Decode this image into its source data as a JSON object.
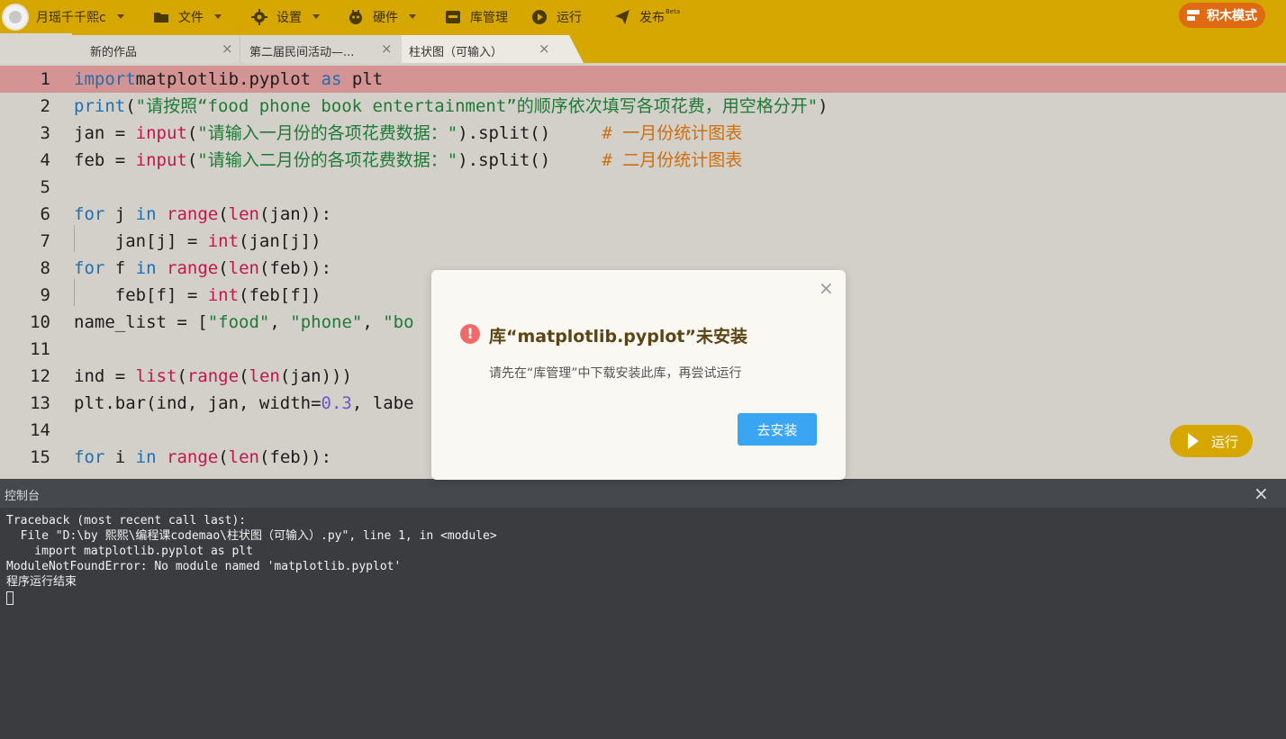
{
  "topbar": {
    "user": "月瑶千千熙c",
    "menu": {
      "file": "文件",
      "settings": "设置",
      "hardware": "硬件",
      "libraries": "库管理",
      "run": "运行",
      "publish": "发布",
      "publish_badge": "Beta"
    },
    "mode_button": "积木模式",
    "colors": {
      "bar": "#d6a700",
      "mode_button": "#e06a12"
    }
  },
  "tabs": [
    {
      "label": "新的作品",
      "close": "×"
    },
    {
      "label": "第二届民间活动—...",
      "close": "×"
    },
    {
      "label": "柱状图（可输入）",
      "close": "×"
    }
  ],
  "editor": {
    "lines": [
      {
        "n": "1",
        "tokens": [
          [
            "kw",
            "import"
          ],
          [
            "",
            "matplotlib.pyplot "
          ],
          [
            "kw",
            "as"
          ],
          [
            "",
            " plt"
          ]
        ]
      },
      {
        "n": "2",
        "tokens": [
          [
            "kw",
            "print"
          ],
          [
            "",
            "("
          ],
          [
            "st",
            "\"请按照“food phone book entertainment”的顺序依次填写各项花费，用空格分开\""
          ],
          [
            "",
            ")"
          ]
        ]
      },
      {
        "n": "3",
        "tokens": [
          [
            "",
            "jan = "
          ],
          [
            "fn",
            "input"
          ],
          [
            "",
            "("
          ],
          [
            "st",
            "\"请输入一月份的各项花费数据：\""
          ],
          [
            "",
            ").split()     "
          ],
          [
            "cm",
            "# 一月份统计图表"
          ]
        ]
      },
      {
        "n": "4",
        "tokens": [
          [
            "",
            "feb = "
          ],
          [
            "fn",
            "input"
          ],
          [
            "",
            "("
          ],
          [
            "st",
            "\"请输入二月份的各项花费数据：\""
          ],
          [
            "",
            ").split()     "
          ],
          [
            "cm",
            "# 二月份统计图表"
          ]
        ]
      },
      {
        "n": "5",
        "tokens": []
      },
      {
        "n": "6",
        "tokens": [
          [
            "kw",
            "for"
          ],
          [
            "",
            " j "
          ],
          [
            "kw",
            "in"
          ],
          [
            "",
            " "
          ],
          [
            "fn",
            "range"
          ],
          [
            "",
            "("
          ],
          [
            "fn",
            "len"
          ],
          [
            "",
            "(jan)):"
          ]
        ]
      },
      {
        "n": "7",
        "tokens": [
          [
            "",
            "    jan[j] = "
          ],
          [
            "fn",
            "int"
          ],
          [
            "",
            "(jan[j])"
          ]
        ]
      },
      {
        "n": "8",
        "tokens": [
          [
            "kw",
            "for"
          ],
          [
            "",
            " f "
          ],
          [
            "kw",
            "in"
          ],
          [
            "",
            " "
          ],
          [
            "fn",
            "range"
          ],
          [
            "",
            "("
          ],
          [
            "fn",
            "len"
          ],
          [
            "",
            "(feb)):"
          ]
        ]
      },
      {
        "n": "9",
        "tokens": [
          [
            "",
            "    feb[f] = "
          ],
          [
            "fn",
            "int"
          ],
          [
            "",
            "(feb[f])"
          ]
        ]
      },
      {
        "n": "10",
        "tokens": [
          [
            "",
            "name_list = ["
          ],
          [
            "st",
            "\"food\""
          ],
          [
            "",
            ", "
          ],
          [
            "st",
            "\"phone\""
          ],
          [
            "",
            ", "
          ],
          [
            "st",
            "\"bo"
          ]
        ]
      },
      {
        "n": "11",
        "tokens": []
      },
      {
        "n": "12",
        "tokens": [
          [
            "",
            "ind = "
          ],
          [
            "fn",
            "list"
          ],
          [
            "",
            "("
          ],
          [
            "fn",
            "range"
          ],
          [
            "",
            "("
          ],
          [
            "fn",
            "len"
          ],
          [
            "",
            "(jan)))"
          ]
        ]
      },
      {
        "n": "13",
        "tokens": [
          [
            "",
            "plt.bar(ind, jan, width="
          ],
          [
            "nm",
            "0.3"
          ],
          [
            "",
            ", labe"
          ]
        ]
      },
      {
        "n": "14",
        "tokens": []
      },
      {
        "n": "15",
        "tokens": [
          [
            "kw",
            "for"
          ],
          [
            "",
            " i "
          ],
          [
            "kw",
            "in"
          ],
          [
            "",
            " "
          ],
          [
            "fn",
            "range"
          ],
          [
            "",
            "("
          ],
          [
            "fn",
            "len"
          ],
          [
            "",
            "(feb)):"
          ]
        ]
      }
    ],
    "run_button": "运行"
  },
  "console": {
    "title": "控制台",
    "close": "×",
    "lines": [
      "Traceback (most recent call last):",
      "  File \"D:\\by 熙熙\\编程课codemao\\柱状图（可输入）.py\", line 1, in <module>",
      "    import matplotlib.pyplot as plt",
      "ModuleNotFoundError: No module named 'matplotlib.pyplot'",
      "程序运行结束"
    ]
  },
  "dialog": {
    "close": "×",
    "icon": "!",
    "title": "库“matplotlib.pyplot”未安装",
    "message": "请先在“库管理”中下载安装此库，再尝试运行",
    "button": "去安装"
  }
}
